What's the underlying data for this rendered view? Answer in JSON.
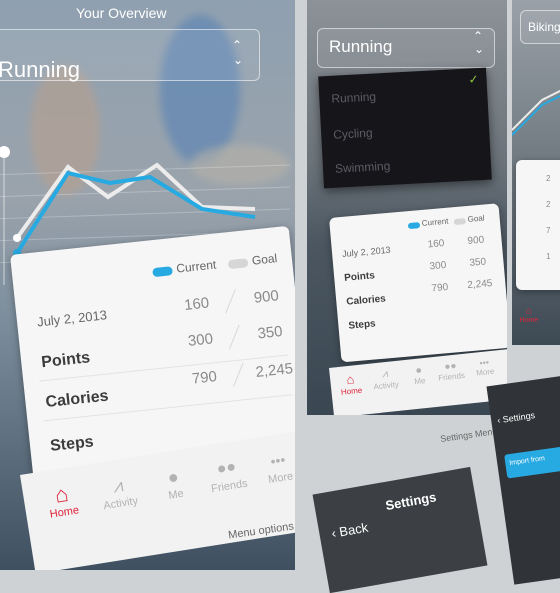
{
  "screen1": {
    "header_title": "Your Overview",
    "activity_selected": "Running",
    "legend": {
      "current": "Current",
      "goal": "Goal"
    },
    "date": "July 2, 2013",
    "stats": [
      {
        "label": "Points",
        "current": "160",
        "goal": "900"
      },
      {
        "label": "Calories",
        "current": "300",
        "goal": "350"
      },
      {
        "label": "Steps",
        "current": "790",
        "goal": "2,245"
      }
    ],
    "tabs": [
      {
        "label": "Home",
        "icon": "home-icon"
      },
      {
        "label": "Activity",
        "icon": "activity-icon"
      },
      {
        "label": "Me",
        "icon": "me-icon"
      },
      {
        "label": "Friends",
        "icon": "friends-icon"
      },
      {
        "label": "More",
        "icon": "more-icon"
      }
    ],
    "bottom_caption": "Menu options"
  },
  "screen2": {
    "activity_selected": "Running",
    "dropdown_options": [
      "Running",
      "Cycling",
      "Swimming"
    ],
    "legend": {
      "current": "Current",
      "goal": "Goal"
    },
    "date": "July 2, 2013",
    "stats": [
      {
        "label": "Points",
        "current": "160",
        "goal": "900"
      },
      {
        "label": "Calories",
        "current": "300",
        "goal": "350"
      },
      {
        "label": "Steps",
        "current": "790",
        "goal": "2,245"
      }
    ],
    "tabs": [
      "Home",
      "Activity",
      "Me",
      "Friends",
      "More"
    ],
    "bottom_caption": "Settings Menu",
    "settings_back": "Back",
    "settings_title": "Settings"
  },
  "screen3": {
    "activity_selected": "Biking",
    "legend_values": [
      "2",
      "2",
      "7",
      "1"
    ],
    "tab_home": "Home",
    "settings_back": "Settings",
    "import_label": "Import from"
  },
  "colors": {
    "accent": "#27a9e1",
    "goal": "#d6d6d6",
    "active_tab": "#e0243a"
  }
}
